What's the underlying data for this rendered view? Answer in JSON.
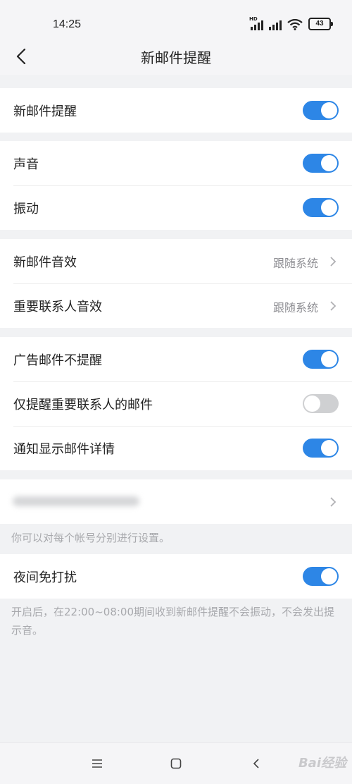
{
  "status_bar": {
    "time": "14:25",
    "battery": "43",
    "signal_badge": "HD"
  },
  "header": {
    "title": "新邮件提醒"
  },
  "groups": {
    "g1": [
      {
        "label": "新邮件提醒",
        "toggle": true
      }
    ],
    "g2": [
      {
        "label": "声音",
        "toggle": true
      },
      {
        "label": "振动",
        "toggle": true
      }
    ],
    "g3": [
      {
        "label": "新邮件音效",
        "value": "跟随系统"
      },
      {
        "label": "重要联系人音效",
        "value": "跟随系统"
      }
    ],
    "g4": [
      {
        "label": "广告邮件不提醒",
        "toggle": true
      },
      {
        "label": "仅提醒重要联系人的邮件",
        "toggle": false
      },
      {
        "label": "通知显示邮件详情",
        "toggle": true
      }
    ],
    "g6": [
      {
        "label": "夜间免打扰",
        "toggle": true
      }
    ]
  },
  "account_note": "你可以对每个帐号分别进行设置。",
  "dnd_note": "开启后，在22:00~08:00期间收到新邮件提醒不会振动，不会发出提示音。",
  "colors": {
    "accent": "#2d86e6",
    "toggle_off": "#cfd0d2",
    "background": "#f1f2f4"
  },
  "watermark": "Bai经验"
}
